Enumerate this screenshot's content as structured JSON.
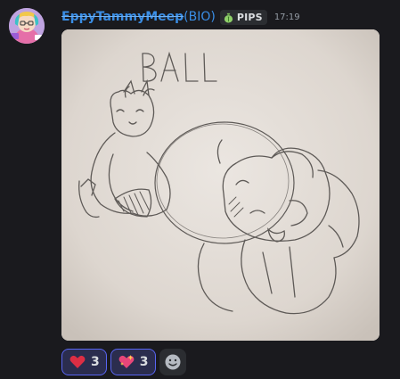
{
  "message": {
    "author": {
      "name_struck": "EppyTammyMeep",
      "name_tail": "(BIO)",
      "avatar_icon": "avatar-anime-girl-icon"
    },
    "role_tag": {
      "icon": "money-bag-icon",
      "label": "PIPS"
    },
    "timestamp": "17:19",
    "attachment": {
      "caption_in_image": "BALL"
    }
  },
  "reactions": [
    {
      "emoji": "red-heart-icon",
      "count": "3"
    },
    {
      "emoji": "sparkling-heart-icon",
      "count": "3"
    }
  ],
  "add_reaction_icon": "add-reaction-smiley-icon",
  "colors": {
    "background": "#1a1a1e",
    "username": "#3a8ee6",
    "reaction_border": "#5865f2",
    "reaction_bg": "#2b2d4e"
  }
}
